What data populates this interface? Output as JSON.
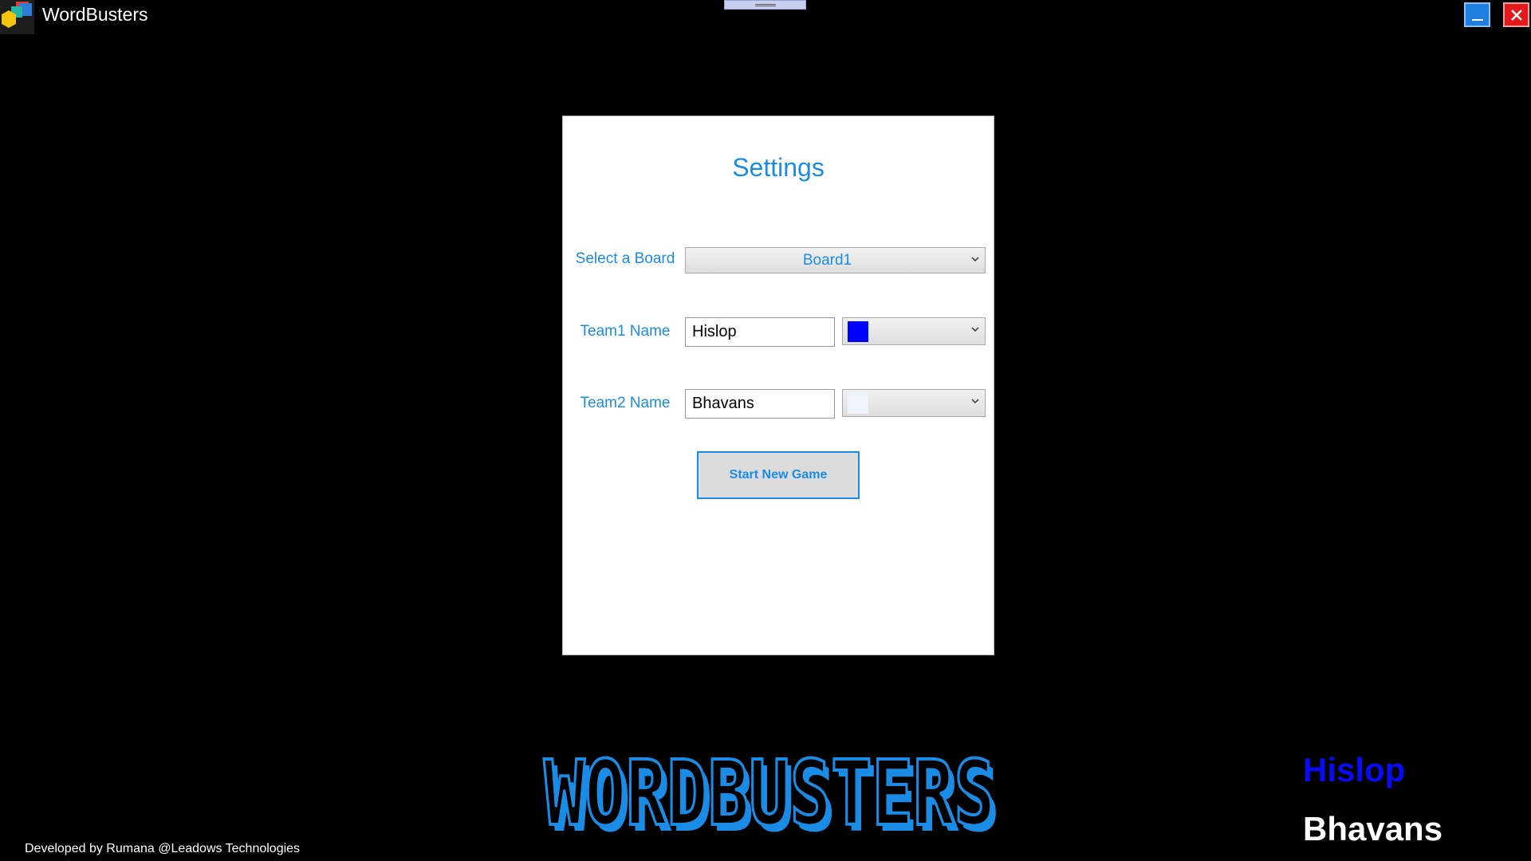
{
  "window": {
    "title": "WordBusters",
    "app_icon": "wordbusters-cubes-icon",
    "minimize_icon": "minimize-icon",
    "close_icon": "close-icon"
  },
  "settings": {
    "title": "Settings",
    "board_label": "Select a Board",
    "board_value": "Board1",
    "team1_label": "Team1 Name",
    "team1_value": "Hislop",
    "team1_color": "#0000ff",
    "team2_label": "Team2 Name",
    "team2_value": "Bhavans",
    "team2_color": "#eef4fb",
    "start_label": "Start New Game"
  },
  "logo_text": "WORDBUSTERS",
  "scoreboard": {
    "team1": "Hislop",
    "team2": "Bhavans"
  },
  "footer": "Developed by Rumana @Leadows Technologies",
  "colors": {
    "accent": "#1a8ce6",
    "background": "#000000",
    "panel": "#ffffff",
    "team1": "#0a0af5",
    "team2": "#ffffff"
  }
}
